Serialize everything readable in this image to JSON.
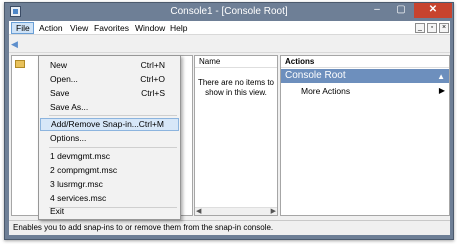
{
  "window": {
    "title": "Console1 - [Console Root]",
    "minimize": "–",
    "maximize": "▢",
    "close": "✕"
  },
  "menubar": {
    "file": "File",
    "action": "Action",
    "view": "View",
    "favorites": "Favorites",
    "window": "Window",
    "help": "Help",
    "mdi_min": "_",
    "mdi_max": "▫",
    "mdi_close": "×"
  },
  "file_menu": {
    "items": [
      {
        "label": "New",
        "shortcut": "Ctrl+N"
      },
      {
        "label": "Open...",
        "shortcut": "Ctrl+O"
      },
      {
        "label": "Save",
        "shortcut": "Ctrl+S"
      },
      {
        "label": "Save As...",
        "shortcut": ""
      },
      {
        "label": "Add/Remove Snap-in...",
        "shortcut": "Ctrl+M"
      },
      {
        "label": "Options...",
        "shortcut": ""
      },
      {
        "label": "1 devmgmt.msc",
        "shortcut": ""
      },
      {
        "label": "2 compmgmt.msc",
        "shortcut": ""
      },
      {
        "label": "3 lusrmgr.msc",
        "shortcut": ""
      },
      {
        "label": "4 services.msc",
        "shortcut": ""
      },
      {
        "label": "Exit",
        "shortcut": ""
      }
    ]
  },
  "center_pane": {
    "column_header": "Name",
    "empty_text": "There are no items to show in this view."
  },
  "actions_pane": {
    "header": "Actions",
    "group_title": "Console Root",
    "group_arrow": "▲",
    "more_actions": "More Actions",
    "more_arrow": "▶"
  },
  "status_bar": {
    "text": "Enables you to add snap-ins to or remove them from the snap-in console."
  },
  "colors": {
    "title_bar": "#6e7f96",
    "close_button": "#c7432e",
    "actions_group": "#6d8fbd",
    "menu_highlight": "#d7e7f8"
  }
}
